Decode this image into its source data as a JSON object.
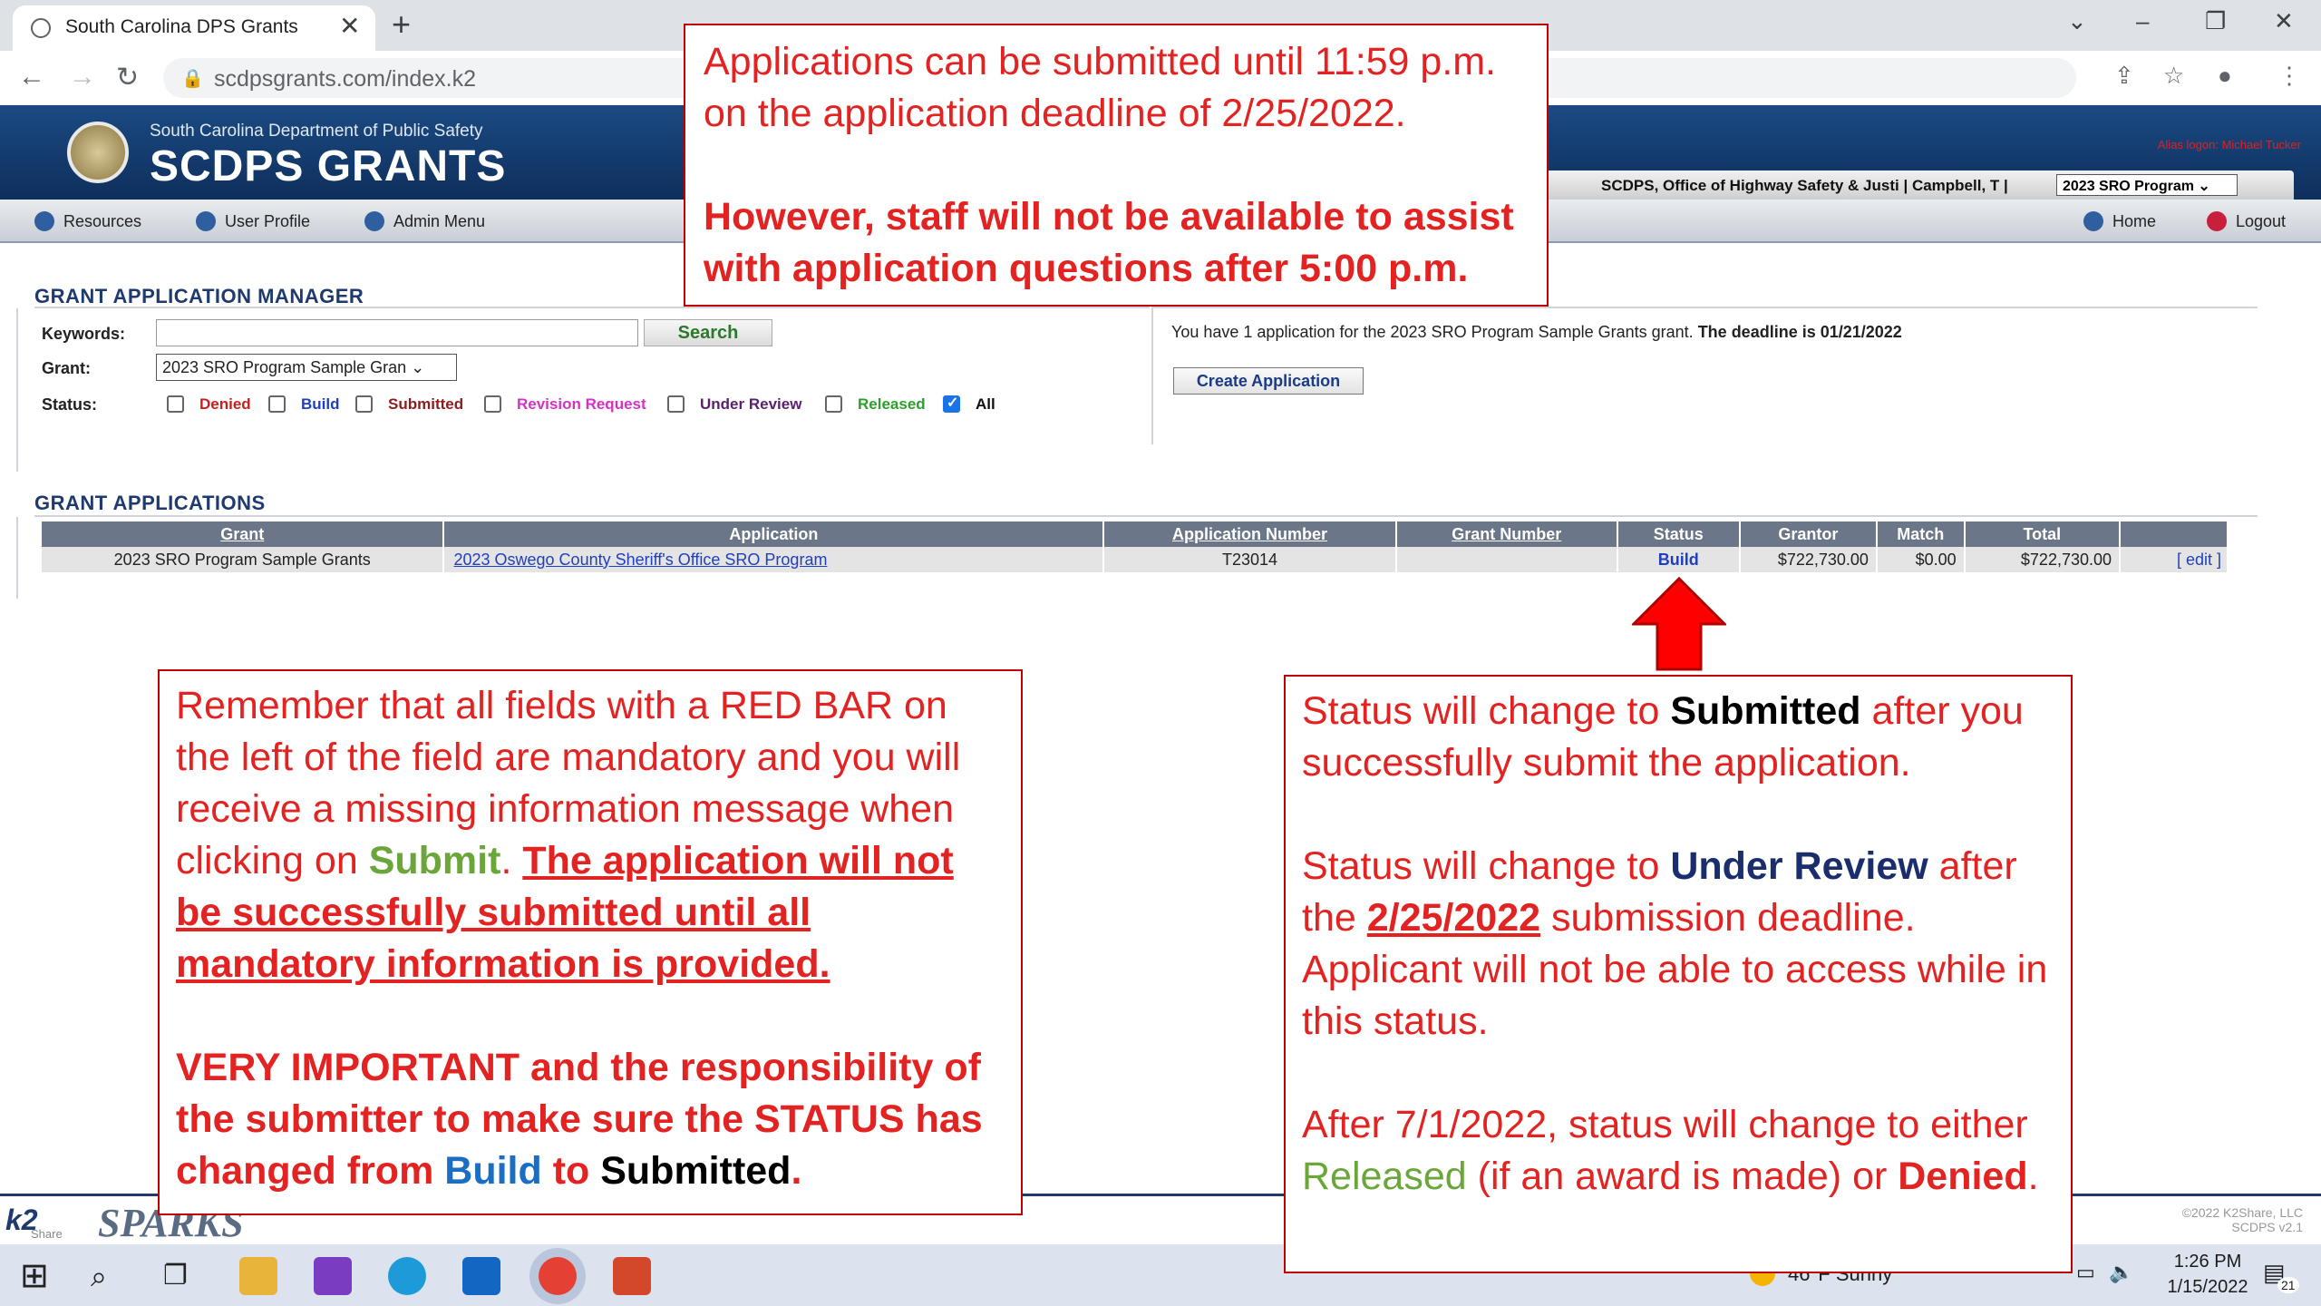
{
  "browser": {
    "tab_title": "South Carolina DPS Grants",
    "tab_close": "✕",
    "new_tab": "+",
    "url": "scdpsgrants.com/index.k2"
  },
  "banner": {
    "dept": "South Carolina Department of Public Safety",
    "brand": "SCDPS GRANTS",
    "alias": "Alias logon: Michael Tucker",
    "org": "SCDPS, Office of Highway Safety & Justi | Campbell, T  |",
    "program_select": "2023 SRO Program ⌄"
  },
  "menu": {
    "resources": "Resources",
    "user_profile": "User Profile",
    "admin_menu": "Admin Menu",
    "home": "Home",
    "logout": "Logout"
  },
  "manager": {
    "title": "GRANT APPLICATION MANAGER",
    "keywords_label": "Keywords:",
    "keywords_value": "",
    "search_label": "Search",
    "grant_label": "Grant:",
    "grant_value": "2023 SRO Program Sample Gran ⌄",
    "status_label": "Status:",
    "statuses": [
      {
        "label": "Denied",
        "color": "#cc1d1d",
        "checked": false
      },
      {
        "label": "Build",
        "color": "#1f3fbf",
        "checked": false
      },
      {
        "label": "Submitted",
        "color": "#8a1d1d",
        "checked": false
      },
      {
        "label": "Revision Request",
        "color": "#d432c6",
        "checked": false
      },
      {
        "label": "Under Review",
        "color": "#5b1f6e",
        "checked": false
      },
      {
        "label": "Released",
        "color": "#2aa02a",
        "checked": false
      },
      {
        "label": "All",
        "color": "#111111",
        "checked": true
      }
    ],
    "info_prefix": "You have 1 application for the 2023 SRO Program Sample Grants grant.",
    "info_deadline": "The deadline is 01/21/2022",
    "create_label": "Create Application"
  },
  "applications": {
    "title": "GRANT APPLICATIONS",
    "headers": [
      "Grant",
      "Application",
      "Application Number",
      "Grant Number",
      "Status",
      "Grantor",
      "Match",
      "Total",
      ""
    ],
    "row": {
      "grant": "2023 SRO Program Sample Grants",
      "application": "2023 Oswego County Sheriff's Office SRO Program",
      "app_number": "T23014",
      "grant_number": "",
      "status": "Build",
      "grantor": "$722,730.00",
      "match": "$0.00",
      "total": "$722,730.00",
      "edit": "[ edit ]"
    }
  },
  "callouts": {
    "top": {
      "line1": "Applications can be submitted until 11:59 p.m.",
      "line2": "on the application deadline of 2/25/2022.",
      "line3": "However, staff will not be available to assist",
      "line4": "with application questions after 5:00 p.m."
    },
    "left": {
      "p1_a": "Remember that all fields with a RED BAR on the left of the field are mandatory and you will receive a missing information message when clicking on ",
      "p1_submit": "Submit",
      "p1_dot": ". ",
      "p1_under": "The application will not be successfully submitted until all mandatory information is provided.",
      "p2_a": "VERY IMPORTANT and the responsibility of the submitter to make sure the STATUS has changed from ",
      "p2_build": "Build",
      "p2_to": " to ",
      "p2_submitted": "Submitted",
      "p2_dot": "."
    },
    "right": {
      "p1_a": "Status will change to ",
      "p1_submitted": "Submitted",
      "p1_b": " after you successfully submit the application.",
      "p2_a": "Status will change to ",
      "p2_review": "Under Review",
      "p2_b": " after the ",
      "p2_date": "2/25/2022",
      "p2_c": " submission deadline. Applicant will not be able to access while in this status.",
      "p3_a": "After 7/1/2022, status will change to either ",
      "p3_released": "Released",
      "p3_b": " (if an award is made) or ",
      "p3_denied": "Denied",
      "p3_c": "."
    }
  },
  "footer": {
    "k2": "k2",
    "k2_sub": "Share",
    "sparks": "SPARKS",
    "copy1": "©2022 K2Share, LLC",
    "copy2": "SCDPS v2.1"
  },
  "taskbar": {
    "weather": "46°F  Sunny",
    "time": "1:26 PM",
    "date": "1/15/2022",
    "notif": "21"
  }
}
